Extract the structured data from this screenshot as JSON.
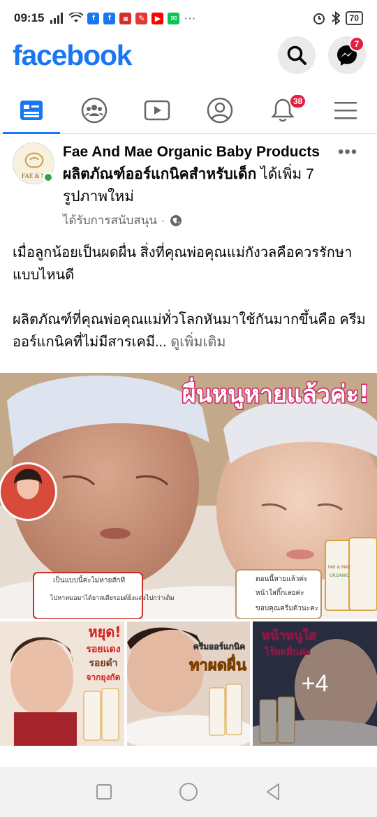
{
  "status_bar": {
    "time": "09:15",
    "battery": "70"
  },
  "header": {
    "logo": "facebook",
    "messenger_badge": "7"
  },
  "nav": {
    "notifications_badge": "38"
  },
  "post": {
    "page_name": "Fae And Mae Organic Baby Products ผลิตภัณฑ์ออร์แกนิคสำหรับเด็ก",
    "action": "ได้เพิ่ม 7 รูปภาพใหม่",
    "sponsored": "ได้รับการสนับสนุน",
    "dot": "·",
    "paragraph1": "เมื่อลูกน้อยเป็นผดผื่น สิ่งที่คุณพ่อคุณแม่กังวลคือควรรักษาแบบไหนดี",
    "paragraph2": "ผลิตภัณฑ์ที่คุณพ่อคุณแม่ทั่วโลกหันมาใช้กันมากขึ้นคือ ครีมออร์แกนิคที่ไม่มีสารเคมี...",
    "see_more": "ดูเพิ่มเติม"
  },
  "photos": {
    "main_headline": "ผื่นหนูหายแล้วค่ะ!",
    "left_bubble": [
      "เป็นแบบนี้ค่ะไม่หายสักที",
      "ไปหาหมอมาได้ยาสเตียรอยด์ยิ่งแดงไปกว่าเดิม"
    ],
    "right_bubble": [
      "ตอนนี้หายแล้วค่ะ",
      "หน้าใสกิ๊กเลยค่ะ",
      "ขอบคุณครีมตัวนะคะ"
    ],
    "tube_brand": "FAE & MAE",
    "tube_sub": "ORGANIC",
    "avatar_brand": "FAE & M",
    "thumb1_text": [
      "หยุด!",
      "รอยแดง",
      "รอยดำ",
      "จากยุงกัด"
    ],
    "thumb2_text": [
      "ครีมออร์แกนิค",
      "ทาผดผื่น"
    ],
    "thumb3_text": [
      "หน้าหนูใส",
      "ไร้ผดผื่นค่ะ"
    ],
    "more_count": "+4"
  },
  "colors": {
    "brand": "#1877f2",
    "badge": "#e41e3f",
    "online": "#31a24c",
    "muted": "#65676b"
  }
}
